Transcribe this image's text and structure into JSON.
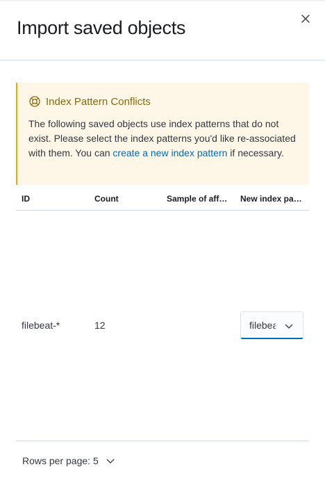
{
  "flyout": {
    "title": "Import saved objects",
    "close_icon": "close-icon"
  },
  "callout": {
    "icon": "help-lifebuoy-icon",
    "title": "Index Pattern Conflicts",
    "body_before_link": "The following saved objects use index patterns that do not exist. Please select the index patterns you'd like re-associated with them. You can ",
    "link_text": "create a new index pattern",
    "body_after_link": " if necessary.",
    "accent_color": "#f5a700",
    "background_color": "#fef6e6"
  },
  "table": {
    "columns": [
      "ID",
      "Count",
      "Sample of aff…",
      "New index pa…"
    ],
    "rows": [
      {
        "id": "filebeat-*",
        "count": "12",
        "sample": "",
        "new_index_pattern": "filebea"
      }
    ]
  },
  "pagination": {
    "rows_per_page_label": "Rows per page: 5"
  },
  "colors": {
    "link": "#006bb8",
    "border": "#d3dae6"
  }
}
